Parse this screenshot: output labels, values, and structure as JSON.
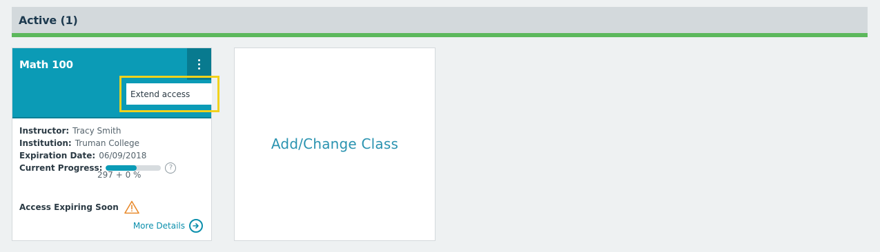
{
  "section": {
    "title": "Active (1)"
  },
  "class_card": {
    "name": "Math 100",
    "menu": {
      "item": "Extend access"
    },
    "instructor": {
      "label": "Instructor:",
      "value": "Tracy Smith"
    },
    "institution": {
      "label": "Institution:",
      "value": "Truman College"
    },
    "expiration": {
      "label": "Expiration Date:",
      "value": "06/09/2018"
    },
    "progress": {
      "label": "Current Progress:",
      "fraction": 0.56,
      "text": "297 + 0 %",
      "help": "?"
    },
    "status": "Access Expiring Soon",
    "more_details": "More Details"
  },
  "add_card": {
    "label": "Add/Change Class"
  },
  "colors": {
    "banner": "#0b9bb6",
    "header_underline": "#5cb85c",
    "warning": "#e8892a",
    "highlight": "#f2d21b"
  }
}
